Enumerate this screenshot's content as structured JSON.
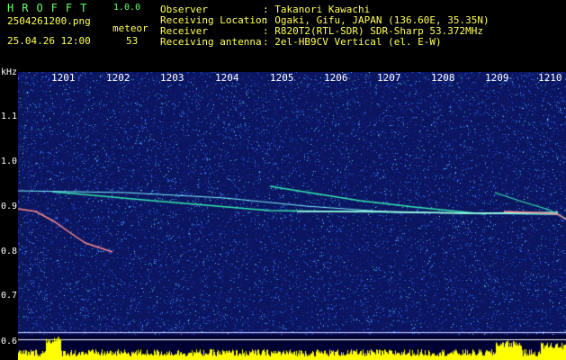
{
  "app": {
    "logo": "HROFFT",
    "version": "1.0.0",
    "filename": "2504261200.png",
    "meteor_label": "meteor",
    "date_time": "25.04.26 12:00",
    "meteor_count": "53"
  },
  "info": [
    {
      "key": "Observer",
      "value": ": Takanori Kawachi"
    },
    {
      "key": "Receiving Location",
      "value": ": Ogaki, Gifu, JAPAN (136.60E, 35.35N)"
    },
    {
      "key": "Receiver",
      "value": ": R820T2(RTL-SDR) SDR-Sharp 53.372MHz"
    },
    {
      "key": "Receiving antenna",
      "value": ": 2el-HB9CV Vertical (el. E-W)"
    }
  ],
  "axis": {
    "unit": "kHz",
    "time_ticks": [
      "1201",
      "1202",
      "1203",
      "1204",
      "1205",
      "1206",
      "1207",
      "1208",
      "1209",
      "1210"
    ],
    "freq_ticks": [
      "1.1",
      "1.0",
      "0.9",
      "0.8",
      "0.7",
      "0.6"
    ]
  },
  "colors": {
    "background": "#000000",
    "spectrum_bg": "#0b1560",
    "noise": "#3a7dff",
    "echo": "#35e8b0",
    "baseline": "#ffff00",
    "header_text": "#ffff55",
    "logo_text": "#66ff66"
  }
}
